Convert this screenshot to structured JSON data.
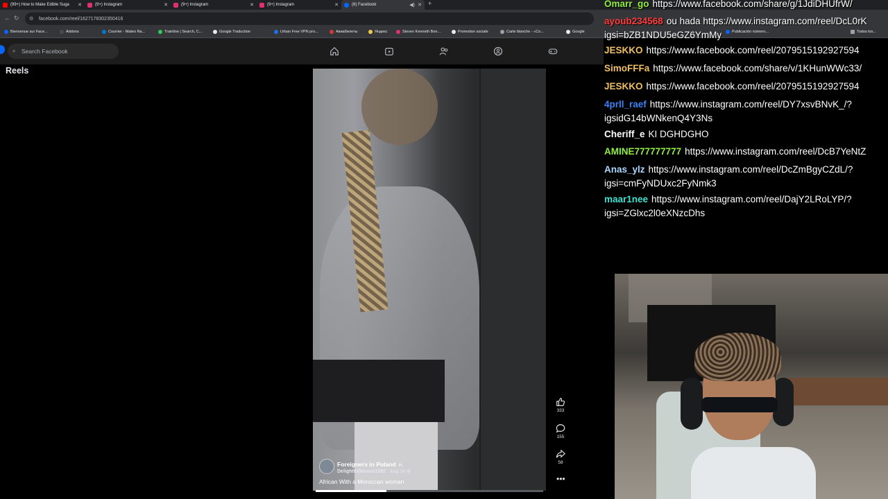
{
  "browser": {
    "tabs": [
      {
        "title": "(99+) How to Make Edible Suga",
        "color": "#ff0000",
        "active": false
      },
      {
        "title": "(9+) Instagram",
        "color": "#e1306c",
        "active": false
      },
      {
        "title": "(9+) Instagram",
        "color": "#e1306c",
        "active": false
      },
      {
        "title": "(9+) Instagram",
        "color": "#e1306c",
        "active": false
      },
      {
        "title": "(6) Facebook",
        "color": "#0866ff",
        "active": true
      }
    ],
    "url": "facebook.com/reel/1627178302350416",
    "bookmarks": [
      "Bienvenue sur Face...",
      "Addons",
      "Courrier - Mateo Ra...",
      "Trainline | Search, C...",
      "Google Traduction",
      "Urban Free VPN pro...",
      "Авиабилеты",
      "Яндекс",
      "Steven Kenneth Bon...",
      "Promotion sociale",
      "Carte blanche - «Co...",
      "Google",
      "Publicación número...",
      "Todos los..."
    ]
  },
  "facebook": {
    "search_placeholder": "Search Facebook",
    "nav_icons": [
      "home-icon",
      "video-icon",
      "friends-icon",
      "groups-icon",
      "gaming-icon"
    ],
    "section_title": "Reels",
    "reel": {
      "page_name": "Foreigners in Poland",
      "page_badge": "PL",
      "username": "DelightfulMouse2382",
      "date": "Aug 24",
      "caption": "African With a Moroccan woman",
      "progress": 0.31,
      "likes": "333",
      "comments": "155",
      "shares": "58"
    }
  },
  "chat": [
    {
      "user": "Omarr_go",
      "color": "#90ee40",
      "text": "https://www.facebook.com/share/g/1JdiDHUfrW/",
      "cont": ""
    },
    {
      "user": "ayoub234568",
      "color": "#ff3b3b",
      "text": "ou hada https://www.instagram.com/reel/DcL0rK",
      "cont": "igsi=bZB1NDU5eGZ6YmMy"
    },
    {
      "user": "JESKKO",
      "color": "#f0c060",
      "text": "https://www.facebook.com/reel/2079515192927594",
      "cont": ""
    },
    {
      "user": "SimoFFFa",
      "color": "#f0c060",
      "text": "https://www.facebook.com/share/v/1KHunWWc33/",
      "cont": ""
    },
    {
      "user": "JESKKO",
      "color": "#f0c060",
      "text": "https://www.facebook.com/reel/2079515192927594",
      "cont": ""
    },
    {
      "user": "4prll_raef",
      "color": "#3b82f6",
      "text": "https://www.instagram.com/reel/DY7xsvBNvK_/?",
      "cont": "igsidG14bWNkenQ4Y3Ns"
    },
    {
      "user": "Cheriff_e",
      "color": "#ffffff",
      "text": "KI DGHDGHO",
      "cont": ""
    },
    {
      "user": "AMINE777777777",
      "color": "#90ee40",
      "text": "https://www.instagram.com/reel/DcB7YeNtZ",
      "cont": ""
    },
    {
      "user": "Anas_ylz",
      "color": "#a8d8ff",
      "text": "https://www.instagram.com/reel/DcZmBgyCZdL/?",
      "cont": "igsi=cmFyNDUxc2FyNmk3"
    },
    {
      "user": "maar1nee",
      "color": "#40e0d0",
      "text": "https://www.instagram.com/reel/DajY2LRoLYP/?",
      "cont": "igsi=ZGlxc2l0eXNzcDhs"
    }
  ]
}
